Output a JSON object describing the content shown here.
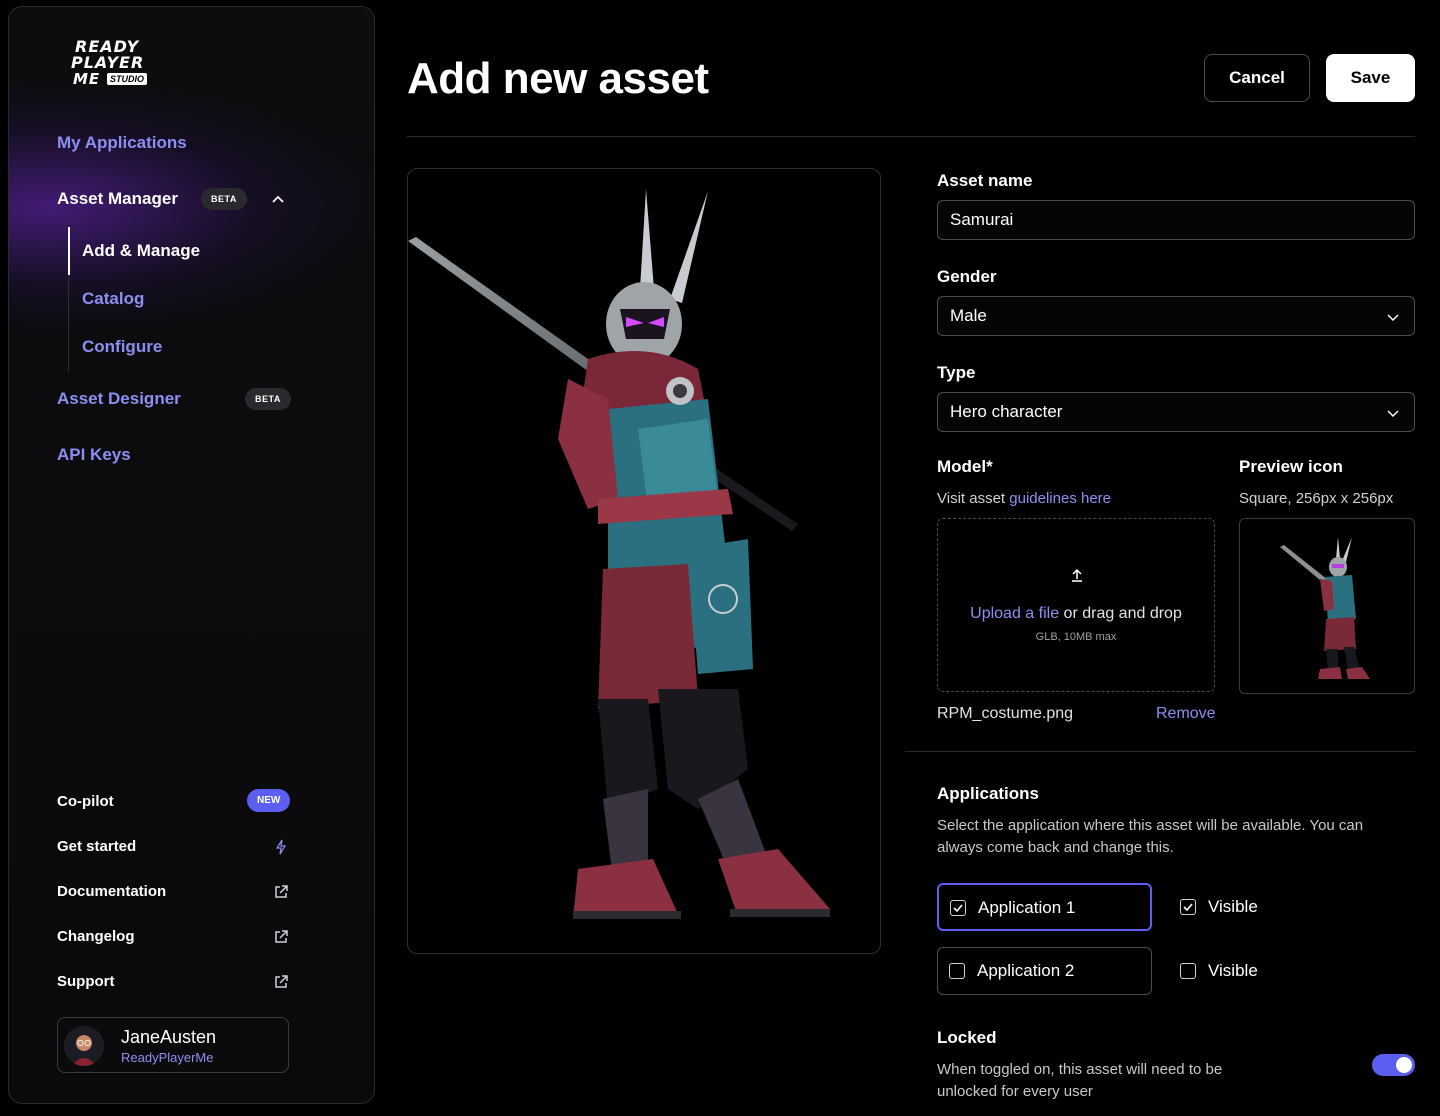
{
  "logo": {
    "line1": "READY",
    "line2": "PLAYER",
    "line3": "ME",
    "studio": "STUDIO"
  },
  "sidebar": {
    "nav": {
      "my_applications": "My Applications",
      "asset_manager": "Asset Manager",
      "asset_manager_badge": "BETA",
      "sub_items": [
        "Add & Manage",
        "Catalog",
        "Configure"
      ],
      "asset_designer": "Asset Designer",
      "asset_designer_badge": "BETA",
      "api_keys": "API Keys"
    },
    "bottom": {
      "copilot": "Co-pilot",
      "copilot_badge": "NEW",
      "get_started": "Get started",
      "documentation": "Documentation",
      "changelog": "Changelog",
      "support": "Support"
    },
    "user": {
      "name": "JaneAusten",
      "org": "ReadyPlayerMe"
    }
  },
  "header": {
    "title": "Add new asset",
    "cancel_label": "Cancel",
    "save_label": "Save"
  },
  "form": {
    "asset_name_label": "Asset name",
    "asset_name_value": "Samurai",
    "gender_label": "Gender",
    "gender_value": "Male",
    "type_label": "Type",
    "type_value": "Hero character",
    "model_label": "Model*",
    "model_helper_prefix": "Visit asset ",
    "model_helper_link": "guidelines here",
    "upload_link": "Upload a file",
    "upload_text": " or drag and drop",
    "upload_sub": "GLB, 10MB max",
    "file_name": "RPM_costume.png",
    "remove_label": "Remove",
    "preview_icon_label": "Preview icon",
    "preview_icon_helper": "Square, 256px x 256px"
  },
  "applications": {
    "title": "Applications",
    "description": "Select the application where this asset will be available. You can always come back and change this.",
    "items": [
      {
        "name": "Application 1",
        "checked": true,
        "visible_label": "Visible",
        "visible": true
      },
      {
        "name": "Application 2",
        "checked": false,
        "visible_label": "Visible",
        "visible": false
      }
    ]
  },
  "locked": {
    "title": "Locked",
    "description": "When toggled on, this asset will need to be unlocked for every user",
    "on": true
  },
  "colors": {
    "accent": "#5b5ef0",
    "link": "#8c8ff0",
    "background": "#000000"
  }
}
